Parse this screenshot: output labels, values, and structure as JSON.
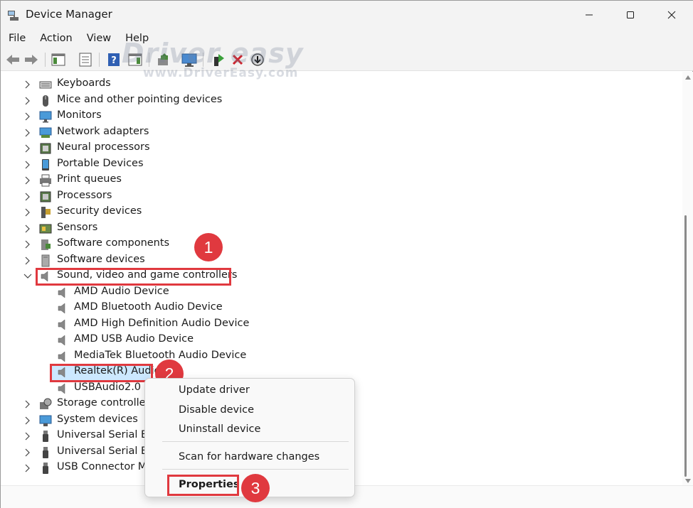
{
  "window": {
    "title": "Device Manager",
    "controls": {
      "minimize": "minimize",
      "maximize": "maximize",
      "close": "close"
    }
  },
  "menu": [
    "File",
    "Action",
    "View",
    "Help"
  ],
  "toolbar": {
    "icons": [
      "back-arrow-icon",
      "forward-arrow-icon",
      "show-hide-tree-icon",
      "properties-icon",
      "help-icon",
      "action-pane-icon",
      "scan-hardware-icon",
      "update-driver-icon",
      "enable-device-icon",
      "uninstall-device-icon",
      "disable-device-icon"
    ]
  },
  "watermark": {
    "main": "Driver easy",
    "sub": "www.DriverEasy.com"
  },
  "tree": {
    "categories": [
      {
        "label": "Keyboards",
        "icon": "keyboard-icon",
        "expanded": false
      },
      {
        "label": "Mice and other pointing devices",
        "icon": "mouse-icon",
        "expanded": false
      },
      {
        "label": "Monitors",
        "icon": "monitor-icon",
        "expanded": false
      },
      {
        "label": "Network adapters",
        "icon": "network-adapter-icon",
        "expanded": false
      },
      {
        "label": "Neural processors",
        "icon": "chip-icon",
        "expanded": false
      },
      {
        "label": "Portable Devices",
        "icon": "portable-device-icon",
        "expanded": false
      },
      {
        "label": "Print queues",
        "icon": "printer-icon",
        "expanded": false
      },
      {
        "label": "Processors",
        "icon": "processor-icon",
        "expanded": false
      },
      {
        "label": "Security devices",
        "icon": "security-key-icon",
        "expanded": false
      },
      {
        "label": "Sensors",
        "icon": "sensor-icon",
        "expanded": false
      },
      {
        "label": "Software components",
        "icon": "software-component-icon",
        "expanded": false
      },
      {
        "label": "Software devices",
        "icon": "software-device-icon",
        "expanded": false
      },
      {
        "label": "Sound, video and game controllers",
        "icon": "speaker-icon",
        "expanded": true
      }
    ],
    "sound_children": [
      {
        "label": "AMD Audio Device",
        "selected": false
      },
      {
        "label": "AMD Bluetooth Audio Device",
        "selected": false
      },
      {
        "label": "AMD High Definition Audio Device",
        "selected": false
      },
      {
        "label": "AMD USB Audio Device",
        "selected": false
      },
      {
        "label": "MediaTek Bluetooth Audio Device",
        "selected": false
      },
      {
        "label": "Realtek(R) Audio",
        "selected": true
      },
      {
        "label": "USBAudio2.0",
        "selected": false
      }
    ],
    "after": [
      {
        "label": "Storage controllers",
        "icon": "storage-icon"
      },
      {
        "label": "System devices",
        "icon": "system-device-icon"
      },
      {
        "label": "Universal Serial Bus",
        "icon": "usb-icon"
      },
      {
        "label": "Universal Serial Bus",
        "icon": "usb-icon"
      },
      {
        "label": "USB Connector Ma",
        "icon": "usb-icon"
      }
    ]
  },
  "context_menu": {
    "items": [
      "Update driver",
      "Disable device",
      "Uninstall device",
      "Scan for hardware changes",
      "Properties"
    ]
  },
  "annotations": {
    "step1": "1",
    "step2": "2",
    "step3": "3"
  },
  "colors": {
    "highlight": "#e0393f",
    "selection": "#cce8ff"
  }
}
